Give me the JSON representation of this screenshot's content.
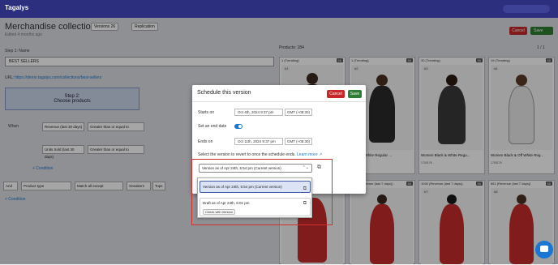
{
  "nav": {
    "logo": "Tagalys"
  },
  "header": {
    "title": "Merchandise collection",
    "subtitle": "Edited 4 months ago",
    "versions_label": "Versions",
    "versions_count": "26",
    "replication_label": "Replication",
    "cancel_label": "Cancel",
    "save_label": "Save"
  },
  "step1": {
    "label": "Step 1: Name",
    "name_value": "BEST SELLERS",
    "url_label": "URL:",
    "url_value": "https://demo.tagalys.com/collections/best-sellers"
  },
  "step2": {
    "title": "Step 2:",
    "subtitle": "Choose products"
  },
  "conditions": {
    "when": "When",
    "row1_field": "Revenue (last 30 days)",
    "row1_op": "Greater than or equal to",
    "row2_field": "Units Sold (last 30 days)",
    "row2_op": "Greater than or equal to",
    "add_condition": "+ Condition",
    "and": "And",
    "product_type": "Product type",
    "match_all": "Match all except",
    "sneakers": "Sneakers",
    "tops": "Tops",
    "add_condition2": "+ Condition"
  },
  "products": {
    "count_label": "Products: 184",
    "pager": "1 / 1",
    "cards": [
      {
        "head": "1 (Trending)",
        "badge": "66",
        "idx": "#1",
        "name": "",
        "stats": ""
      },
      {
        "head": "1 (Trending)",
        "badge": "66",
        "idx": "#2",
        "name": "Black & White Regular ...",
        "stats": "1700176"
      },
      {
        "head": "30 (Trending)",
        "badge": "66",
        "idx": "#3",
        "name": "Women Black & White Regu...",
        "stats": "1700176"
      },
      {
        "head": "19 (Trending)",
        "badge": "66",
        "idx": "#4",
        "name": "Women Black & Off White Reg...",
        "stats": "1700176"
      },
      {
        "head": "",
        "badge": "",
        "idx": "",
        "name": "",
        "stats": ""
      },
      {
        "head": "1045 (Revenue (last 7 days))",
        "badge": "66",
        "idx": "#6",
        "name": "",
        "stats": ""
      },
      {
        "head": "1040 (Revenue (last 7 days))",
        "badge": "66",
        "idx": "#7",
        "name": "",
        "stats": ""
      },
      {
        "head": "661 (Revenue (last 7 days))",
        "badge": "66",
        "idx": "#8",
        "name": "",
        "stats": ""
      }
    ]
  },
  "modal": {
    "title": "Schedule this version",
    "cancel_label": "Cancel",
    "save_label": "Save",
    "starts_on_label": "Starts on",
    "starts_on_value": "Oct 4th, 2024 9:37 pm",
    "starts_tz": "GMT (+05:30)",
    "end_date_label": "Set an end date",
    "ends_on_label": "Ends on",
    "ends_on_value": "Oct 11th, 2024 9:37 pm",
    "ends_tz": "GMT (+05:30)",
    "revert_question": "Select the version to revert to once the schedule ends.",
    "learn_more": "Learn more",
    "selected_version": "Version as of Apr 24th, 5:54 pm (Current version)"
  },
  "dropdown": {
    "option1": "Version as of Apr 24th, 5:54 pm (Current version)",
    "option2": "Draft as of Apr 24th, 6:01 pm",
    "check_with_version": "Check with Version"
  },
  "colors": {
    "nav": "#2b2f7e",
    "accent": "#1976d2",
    "cancel": "#c62828",
    "save": "#2e7d32",
    "highlight": "#d32f2f"
  }
}
